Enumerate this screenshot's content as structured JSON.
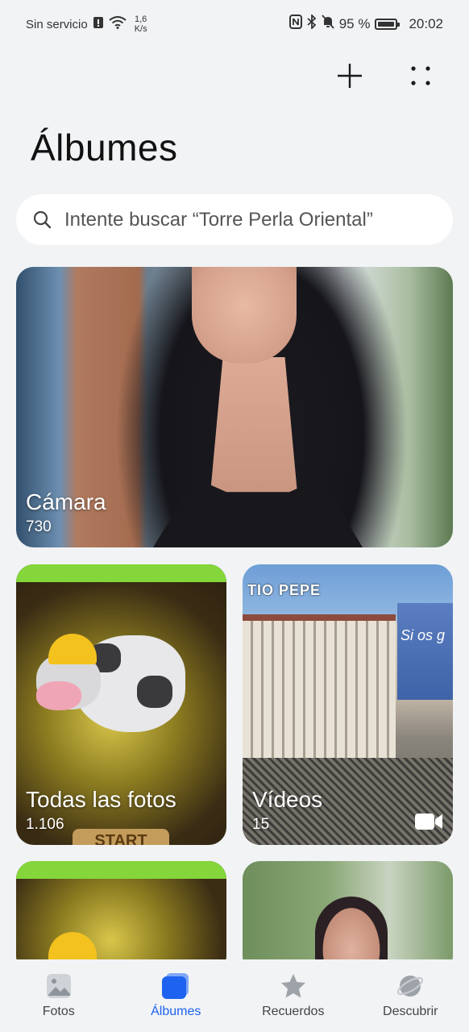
{
  "status_bar": {
    "carrier": "Sin servicio",
    "speed_value": "1,6",
    "speed_unit": "K/s",
    "battery": "95 %",
    "time": "20:02"
  },
  "header": {
    "title": "Álbumes"
  },
  "search": {
    "placeholder": "Intente buscar “Torre Perla Oriental”"
  },
  "albums": [
    {
      "name": "Cámara",
      "count": "730"
    },
    {
      "name": "Todas las fotos",
      "count": "1.106"
    },
    {
      "name": "Vídeos",
      "count": "15"
    }
  ],
  "game_thumb": {
    "start_label": "START"
  },
  "billboard_text": {
    "neon_sign": "TIO PEPE",
    "ad_text": "Si os g"
  },
  "bottom_nav": [
    {
      "label": "Fotos",
      "icon": "photo-icon"
    },
    {
      "label": "Álbumes",
      "icon": "albums-icon",
      "active": true
    },
    {
      "label": "Recuerdos",
      "icon": "star-icon"
    },
    {
      "label": "Descubrir",
      "icon": "planet-icon"
    }
  ],
  "colors": {
    "accent": "#1e62f0",
    "background": "#f1f3f5"
  }
}
